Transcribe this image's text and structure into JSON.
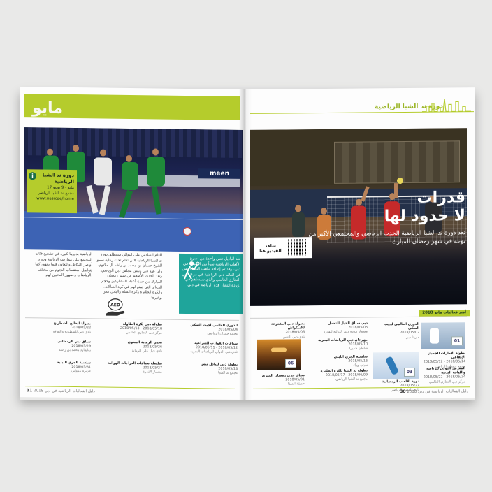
{
  "spread": {
    "left_page": {
      "month_title": "مايو",
      "event_badge": {
        "name": "دورة ند الشبا الرياضية",
        "dates": "17 مايو - 9 يونيو",
        "venue": "مجمع ند الشبا الرياضي",
        "website": "www.nasrcae/home"
      },
      "callout_text": "تعد الباديل تنس واحدة من أسرع الألعاب الرياضية نمواً بين الشباب في دبي، وقد تم إضافة ملعب الباديل تنس في العالم دبي الرياضية في مركز دبي التجاري العالمي والذي سيساهم في زيادة انتشار هذه الرياضة في دبي.",
      "body_text_1": "للعام السادس على التوالي ستنطلق دورة ند الشبا الرياضية التي تقام تحت رعاية سمو الشيخ حمدان بن محمد بن راشد آل مكتوم، ولي عهد دبي رئيس مجلس دبي الرياضي، وتعد الحدث الأضخم في شهر رمضان المبارك من حيث أعداد المشاركين وحجم الجوائز التي تمنح لهم في كرة الصالات، والكرة الطائرة وكرة السلة والبادل تنس وغيرها.",
      "body_text_2": "الرياضية بدورها كبيرة في تشجيع فئات المجتمع على ممارسة الرياضة وتعزيز أواصر التكافل والتعاون فيما بينهم، كما يتواصل استقطاب النجوم من مختلف الرياضات وجمهور المحبين لهم.",
      "money_label": "AED",
      "events": [
        {
          "title": "الدوري العالمي لجيت السكي",
          "dates": "2018/05/04",
          "venue": "مجمع حمدان الرياضي"
        },
        {
          "title": "سباقات القوارب الشراعية",
          "dates": "2018/05/11 - 2018/05/12",
          "venue": "نادي دبي الدولي للرياضات البحرية"
        },
        {
          "title": "بطولة دبي للبادل تنس",
          "dates": "2018/05/18",
          "venue": "مجمع ند الشبا"
        },
        {
          "title": "بطولة دبي لكرة الطاولة",
          "dates": "2018/05/13 - 2018/05/18",
          "venue": "مركز دبي التجاري العالمي"
        },
        {
          "title": "تحدي الرماية السنوي",
          "dates": "2018/05/26",
          "venue": "نادي جبل علي للرماية"
        },
        {
          "title": "سلسلة سباقات الدراجات الهوائية",
          "dates": "2018/05/27",
          "venue": "مضمار القدرة"
        },
        {
          "title": "بطولة الخليج للشطرنج",
          "dates": "2018/05/22",
          "venue": "نادي دبي للشطرنج والثقافة"
        },
        {
          "title": "سباق دبي الرمضاني",
          "dates": "2018/05/29",
          "venue": "بوليفارد محمد بن راشد"
        },
        {
          "title": "سلسلة الجري الليلية",
          "dates": "2018/05/31",
          "venue": "جزيرة بلوواترز"
        }
      ],
      "footer": {
        "page_number": "31",
        "title": "دليل الفعاليات الرياضية في دبي 2018"
      }
    },
    "right_page": {
      "series_title": "دورة ند الشبا الرياضية",
      "headline_line1": "قدرات",
      "headline_line2": "لا حدود لها",
      "subhead": "تعد دورة ند الشبا الرياضية الحدث الرياضي والمجتمعي الأكبر من نوعه في شهر رمضان المبارك",
      "qr_caption": "شاهد الفيديو هنا",
      "section_tag": "أهم فعاليات مايو 2018",
      "thumb_badges": [
        "01",
        "06",
        "03"
      ],
      "events": [
        {
          "title": "الدوري العالمي لجيت السكي",
          "dates": "2018/05/02",
          "venue": "مارينا دبي"
        },
        {
          "title": "دبي سباق الخيل للتحمل",
          "dates": "2018/05/05",
          "venue": "مضمار مدينة دبي الدولية للقدرة"
        },
        {
          "title": "بطولة دبي المفتوحة للاسكواش",
          "dates": "2018/05/06",
          "venue": "نادي دبي للتنس"
        },
        {
          "title": "مهرجان دبي للرياضات البحرية",
          "dates": "2018/05/10",
          "venue": "شاطئ جميرا"
        },
        {
          "title": "بطولة الإمارات للجمباز الإيقاعي",
          "dates": "2018/05/12 - 2018/05/14",
          "venue": "مجمع حمدان الرياضي"
        },
        {
          "title": "سلسلة الجري الليلي",
          "dates": "2018/05/16",
          "venue": "سيتي ووك"
        },
        {
          "title": "بطولة ند الشبا للكرة الطائرة",
          "dates": "2018/05/17 - 2018/06/09",
          "venue": "مجمع ند الشبا الرياضي"
        },
        {
          "title": "المعرض الدولي للرياضة واللياقة البدنية",
          "dates": "2018/05/22 - 2018/05/24",
          "venue": "مركز دبي التجاري العالمي"
        },
        {
          "title": "دورة الألعاب الرمضانية",
          "dates": "2018/05/27",
          "venue": "نادي الوصل الرياضي"
        },
        {
          "title": "سباق جري رمضان الخيري",
          "dates": "2018/05/31",
          "venue": "حديقة الصفا"
        }
      ],
      "footer": {
        "page_number": "30",
        "title": "دليل الفعاليات الرياضية في دبي 2018"
      }
    }
  },
  "colors": {
    "accent_green": "#b5cc2c",
    "callout_teal": "#1fa59b",
    "page": "#fdfdfd",
    "background": "#e9e9e8"
  }
}
